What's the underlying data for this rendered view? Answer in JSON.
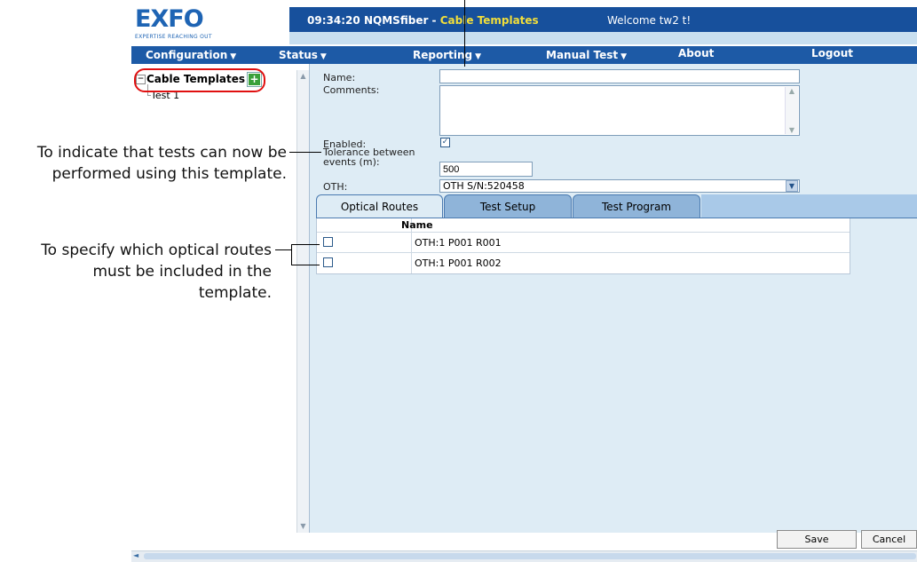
{
  "header": {
    "logo": "EXFO",
    "tagline": "EXPERTISE REACHING OUT",
    "time": "09:34:20",
    "app_name": "NQMSfiber - ",
    "page_name": "Cable Templates",
    "welcome": "Welcome tw2 t!"
  },
  "menu": {
    "items": [
      {
        "label": "Configuration",
        "has_caret": true
      },
      {
        "label": "Status",
        "has_caret": true
      },
      {
        "label": "Reporting",
        "has_caret": true
      },
      {
        "label": "Manual Test",
        "has_caret": true
      },
      {
        "label": "About",
        "has_caret": false
      },
      {
        "label": "Logout",
        "has_caret": false
      }
    ]
  },
  "tree": {
    "root_label": "Cable Templates",
    "root_toggle": "−",
    "add_icon": "add-icon",
    "children": [
      {
        "label": "Test 1"
      }
    ]
  },
  "form": {
    "name_label": "Name:",
    "name_value": "",
    "comments_label": "Comments:",
    "comments_value": "",
    "enabled_label": "Enabled:",
    "enabled_checked": true,
    "tolerance_label_line1": "Tolerance between",
    "tolerance_label_line2": "events (m):",
    "tolerance_value": "500",
    "oth_label": "OTH:",
    "oth_value": "OTH S/N:520458"
  },
  "tabs": [
    {
      "label": "Optical Routes",
      "active": true
    },
    {
      "label": "Test Setup",
      "active": false
    },
    {
      "label": "Test Program",
      "active": false
    }
  ],
  "routes_table": {
    "header": "Name",
    "rows": [
      {
        "checked": false,
        "name": "OTH:1 P001 R001"
      },
      {
        "checked": false,
        "name": "OTH:1 P001 R002"
      }
    ]
  },
  "buttons": {
    "save": "Save",
    "cancel": "Cancel"
  },
  "annotations": {
    "enabled_note_line1": "To indicate that tests can now be",
    "enabled_note_line2": "performed using this template.",
    "routes_note_line1": "To specify which optical routes",
    "routes_note_line2": "must be included in the",
    "routes_note_line3": "template."
  },
  "colors": {
    "topbar": "#17509c",
    "menubar": "#1d5aa6",
    "page_title_highlight": "#f2de3a",
    "content_bg": "#deecf5",
    "tab_active": "#deecf5",
    "tab_inactive": "#8fb4d9",
    "callout_circle": "#e01010"
  }
}
